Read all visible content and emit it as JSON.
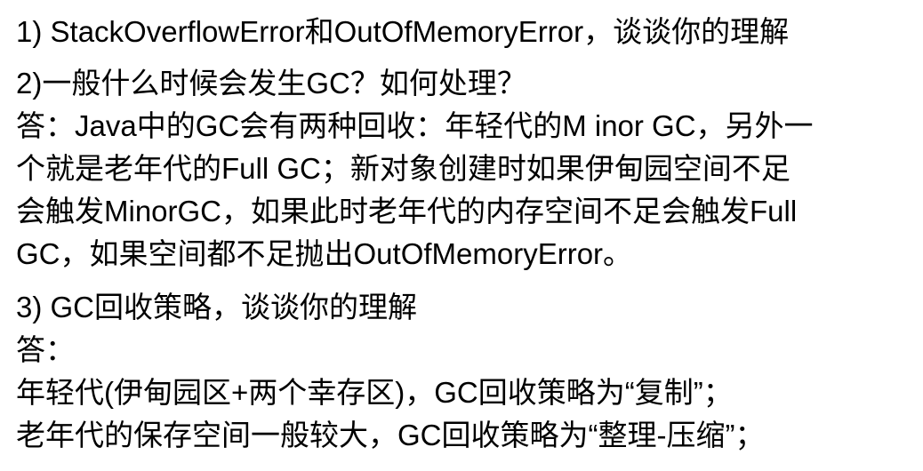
{
  "sections": [
    {
      "lines": [
        "1) StackOverflowError和OutOfMemoryError，谈谈你的理解"
      ]
    },
    {
      "lines": [
        "2)一般什么时候会发生GC？如何处理？",
        "答：Java中的GC会有两种回收：年轻代的M inor GC，另外一",
        "个就是老年代的Full GC；新对象创建时如果伊甸园空间不足",
        "会触发MinorGC，如果此时老年代的内存空间不足会触发Full",
        "GC，如果空间都不足抛出OutOfMemoryError。"
      ]
    },
    {
      "lines": [
        "3) GC回收策略，谈谈你的理解",
        "答：",
        "年轻代(伊甸园区+两个幸存区)，GC回收策略为“复制”；",
        "老年代的保存空间一般较大，GC回收策略为“整理-压缩”；"
      ]
    }
  ]
}
